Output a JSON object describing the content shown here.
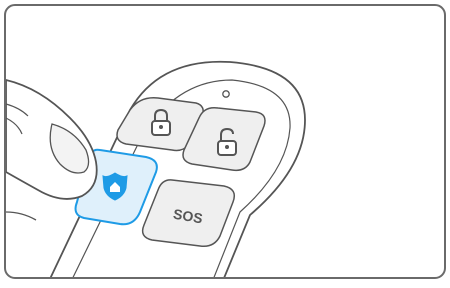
{
  "illustration": {
    "sos_label": "SOS",
    "highlighted_button_icon": "home-shield-icon",
    "other_button_icons": [
      "lock-icon",
      "unlock-icon"
    ],
    "colors": {
      "outline": "#555555",
      "button_fill": "#efefef",
      "highlight": "#1e9be6",
      "highlight_fill": "#dff0fb",
      "frame": "#6a6a6a"
    }
  }
}
